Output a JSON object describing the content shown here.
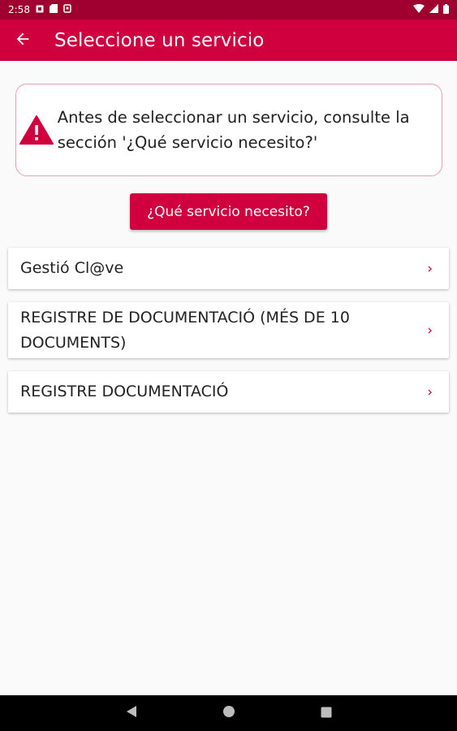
{
  "status_bar": {
    "time": "2:58",
    "icons": [
      "notification-icon",
      "sd-card-icon",
      "shield-icon",
      "wifi-icon",
      "signal-icon",
      "battery-icon"
    ]
  },
  "app_bar": {
    "title": "Seleccione un servicio",
    "back_icon": "arrow-back-icon"
  },
  "alert": {
    "icon": "warning-icon",
    "text": "Antes de seleccionar un servicio, consulte la sección '¿Qué servicio necesito?'"
  },
  "help_button": {
    "label": "¿Qué servicio necesito?"
  },
  "services": [
    {
      "label": "Gestió Cl@ve"
    },
    {
      "label": "REGISTRE DE DOCUMENTACIÓ (MÉS DE 10 DOCUMENTS)"
    },
    {
      "label": "REGISTRE DOCUMENTACIÓ"
    }
  ],
  "chevron_glyph": "›",
  "nav_bar": {
    "icons": [
      "back-triangle-icon",
      "home-circle-icon",
      "recents-square-icon"
    ]
  },
  "colors": {
    "primary": "#d0003f",
    "status_bar": "#a00030",
    "alert_border": "#e3a0b0",
    "background": "#fafafa"
  }
}
